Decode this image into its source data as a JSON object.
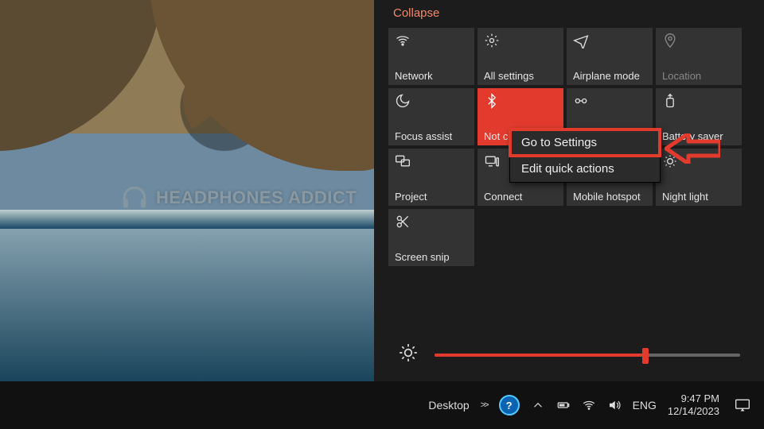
{
  "watermark": {
    "text": "HEADPHONES ADDICT"
  },
  "action_center": {
    "collapse_label": "Collapse",
    "tiles": [
      {
        "id": "network",
        "label": "Network"
      },
      {
        "id": "all-settings",
        "label": "All settings"
      },
      {
        "id": "airplane-mode",
        "label": "Airplane mode"
      },
      {
        "id": "location",
        "label": "Location",
        "disabled": true
      },
      {
        "id": "focus-assist",
        "label": "Focus assist"
      },
      {
        "id": "bluetooth",
        "label": "Not connected",
        "active": true
      },
      {
        "id": "vpn",
        "label": "VPN"
      },
      {
        "id": "battery-saver",
        "label": "Battery saver"
      },
      {
        "id": "project",
        "label": "Project"
      },
      {
        "id": "connect",
        "label": "Connect"
      },
      {
        "id": "mobile-hotspot",
        "label": "Mobile hotspot"
      },
      {
        "id": "night-light",
        "label": "Night light"
      },
      {
        "id": "screen-snip",
        "label": "Screen snip"
      }
    ],
    "context_menu": {
      "items": [
        {
          "id": "go-to-settings",
          "label": "Go to Settings",
          "highlight": true
        },
        {
          "id": "edit-quick-actions",
          "label": "Edit quick actions"
        }
      ]
    },
    "brightness_percent": 68
  },
  "taskbar": {
    "toolbar_label": "Desktop",
    "lang": "ENG",
    "time": "9:47 PM",
    "date": "12/14/2023"
  }
}
